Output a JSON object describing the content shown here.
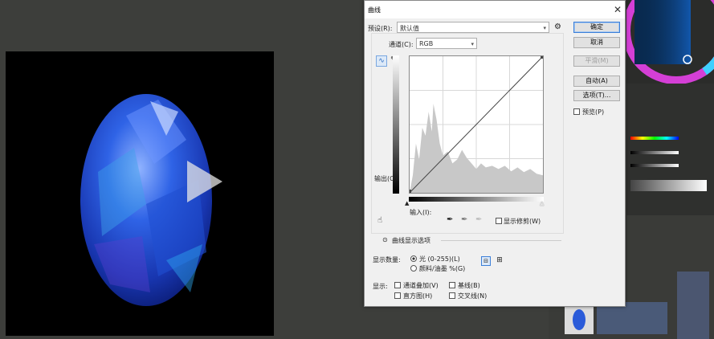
{
  "dialog": {
    "title": "曲线",
    "preset_label": "预设(R):",
    "preset_value": "默认值",
    "channel_label": "通道(C):",
    "channel_value": "RGB",
    "output_label": "输出(O):",
    "input_label": "输入(I):",
    "show_clipping_label": "显示修剪(W)",
    "curve_display_options_label": "曲线显示选项",
    "show_amount_label": "显示数量:",
    "light_option": "光 (0-255)(L)",
    "pigment_option": "颜料/油墨 %(G)",
    "show_label": "显示:",
    "channel_overlays": "通道叠加(V)",
    "baseline": "基线(B)",
    "histogram": "直方图(H)",
    "intersection_line": "交叉线(N)",
    "buttons": {
      "ok": "确定",
      "cancel": "取消",
      "smooth": "平滑(M)",
      "auto": "自动(A)",
      "options": "选项(T)...",
      "preview": "预览(P)"
    }
  },
  "colors": {
    "canvas_bg": "#3d3e3b",
    "gem_blue": "#2a5bd9",
    "dialog_bg": "#f0f0f0",
    "ok_border": "#3c7fd8"
  },
  "icons": [
    "close-icon",
    "gear-icon",
    "curve-tool-icon",
    "pencil-icon",
    "on-image-adjust-icon",
    "black-eyedropper-icon",
    "gray-eyedropper-icon",
    "white-eyedropper-icon",
    "play-icon",
    "collapse-icon",
    "grid-simple-icon",
    "grid-detail-icon"
  ]
}
